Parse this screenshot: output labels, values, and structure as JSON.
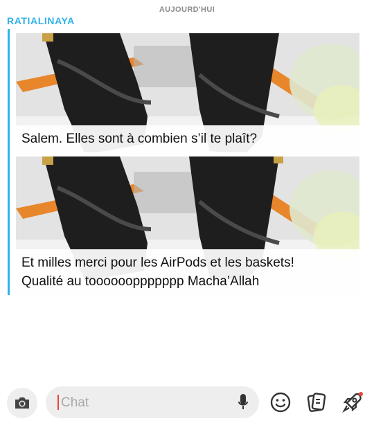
{
  "header": {
    "date_label": "AUJOURD'HUI"
  },
  "thread": {
    "sender": "RATIALINAYA",
    "messages": [
      {
        "caption_lines": [
          "Salem. Elles sont à combien s’il te plaît?"
        ]
      },
      {
        "caption_lines": [
          "Et milles merci pour les AirPods et les baskets!",
          "Qualité au tooooooppppppp Macha’Allah"
        ]
      }
    ]
  },
  "composer": {
    "placeholder": "Chat",
    "icons": [
      "camera-icon",
      "microphone-icon",
      "smiley-icon",
      "sticker-icon",
      "rocket-icon"
    ]
  },
  "colors": {
    "accent": "#2fb3ea",
    "cursor": "#e8453c",
    "orange_box": "#e8862c"
  }
}
